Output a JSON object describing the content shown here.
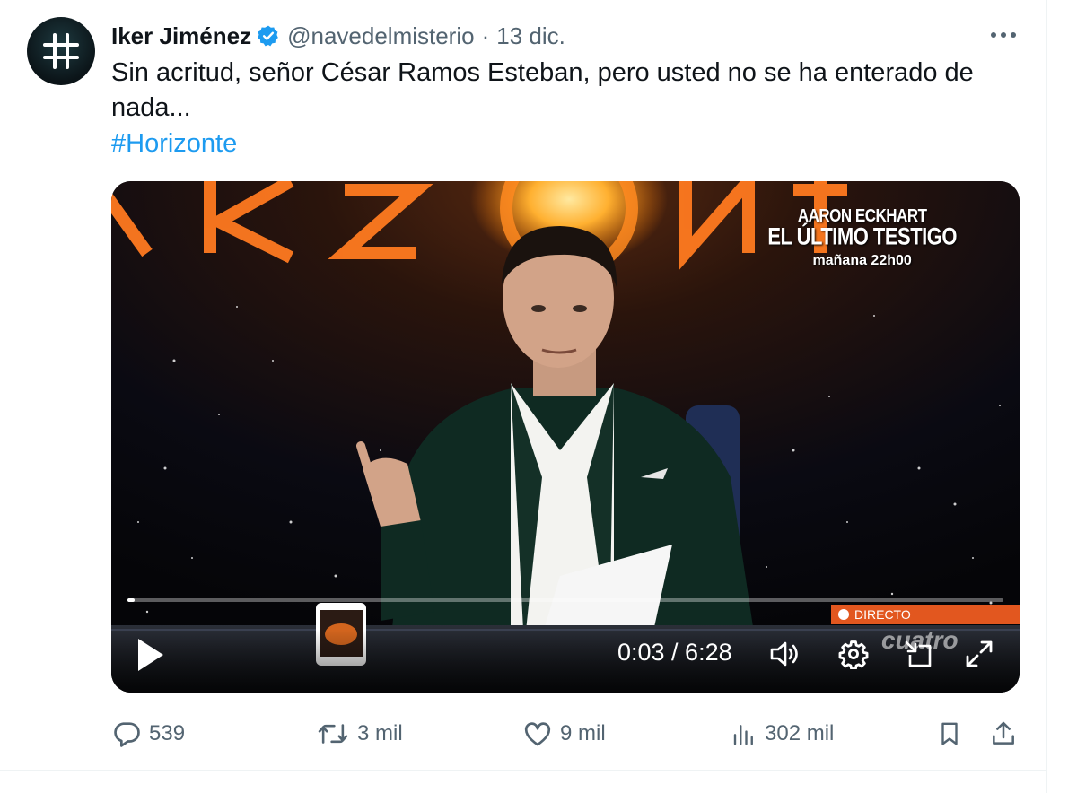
{
  "tweet": {
    "author_name": "Iker Jiménez",
    "handle": "@navedelmisterio",
    "separator": "·",
    "time": "13 dic.",
    "text": "Sin acritud, señor César Ramos Esteban, pero usted no se ha enterado de nada...",
    "hashtag": "#Horizonte"
  },
  "video": {
    "promo_line1": "AARON ECKHART",
    "promo_line2": "EL ÚLTIMO TESTIGO",
    "promo_line3": "mañana 22h00",
    "live_label": "DIRECTO",
    "channel": "cuatro",
    "timecode": "0:03 / 6:28",
    "progress_fraction": 0.008
  },
  "actions": {
    "replies": "539",
    "reposts": "3 mil",
    "likes": "9 mil",
    "views": "302 mil"
  },
  "colors": {
    "accent": "#1d9bf0",
    "secondary_text": "#536471",
    "verified": "#1d9bf0",
    "live_badge": "#e2571f"
  }
}
